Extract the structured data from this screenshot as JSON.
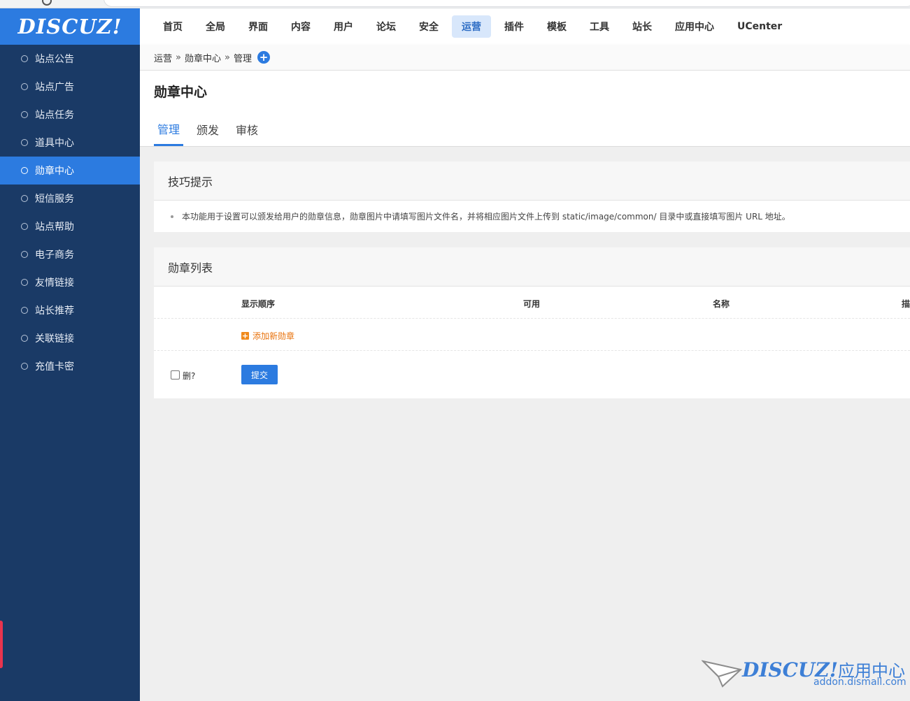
{
  "brand": {
    "logo_text": "DISCUZ!"
  },
  "sidebar": {
    "items": [
      {
        "label": "站点公告"
      },
      {
        "label": "站点广告"
      },
      {
        "label": "站点任务"
      },
      {
        "label": "道具中心"
      },
      {
        "label": "勋章中心",
        "active": true
      },
      {
        "label": "短信服务"
      },
      {
        "label": "站点帮助"
      },
      {
        "label": "电子商务"
      },
      {
        "label": "友情链接"
      },
      {
        "label": "站长推荐"
      },
      {
        "label": "关联链接"
      },
      {
        "label": "充值卡密"
      }
    ]
  },
  "topnav": {
    "items": [
      {
        "label": "首页"
      },
      {
        "label": "全局"
      },
      {
        "label": "界面"
      },
      {
        "label": "内容"
      },
      {
        "label": "用户"
      },
      {
        "label": "论坛"
      },
      {
        "label": "安全"
      },
      {
        "label": "运营",
        "active": true
      },
      {
        "label": "插件"
      },
      {
        "label": "模板"
      },
      {
        "label": "工具"
      },
      {
        "label": "站长"
      },
      {
        "label": "应用中心"
      },
      {
        "label": "UCenter"
      }
    ]
  },
  "breadcrumb": {
    "items": [
      "运营",
      "勋章中心",
      "管理"
    ],
    "separator": "»",
    "add_icon": "+"
  },
  "page": {
    "title": "勋章中心",
    "tabs": [
      {
        "label": "管理",
        "active": true
      },
      {
        "label": "颁发"
      },
      {
        "label": "审核"
      }
    ]
  },
  "tips": {
    "title": "技巧提示",
    "text": "本功能用于设置可以颁发给用户的勋章信息，勋章图片中请填写图片文件名，并将相应图片文件上传到 static/image/common/ 目录中或直接填写图片 URL 地址。"
  },
  "medal_list": {
    "title": "勋章列表",
    "columns": [
      "显示顺序",
      "可用",
      "名称",
      "描"
    ],
    "add_label": "添加新勋章",
    "add_icon": "+",
    "delete_label": "删?",
    "submit_label": "提交"
  },
  "watermark": {
    "brand": "DISCUZ!",
    "cn": "应用中心",
    "domain": "addon.dismall.com"
  },
  "colors": {
    "accent": "#2c7be0",
    "sidebar_bg": "#1a3a66",
    "add_link": "#e8720c"
  }
}
